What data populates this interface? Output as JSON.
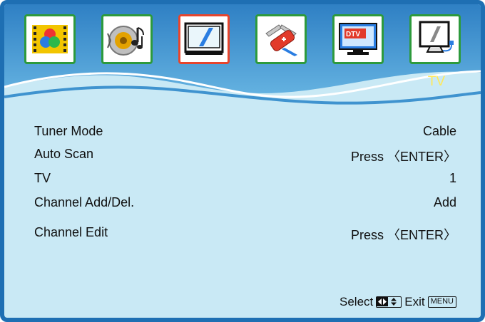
{
  "section_title": "TV",
  "tabs": [
    {
      "icon": "picture-icon",
      "active": false
    },
    {
      "icon": "sound-icon",
      "active": false
    },
    {
      "icon": "tv-icon",
      "active": true
    },
    {
      "icon": "settings-tools-icon",
      "active": false
    },
    {
      "icon": "dtv-icon",
      "active": false
    },
    {
      "icon": "pc-monitor-icon",
      "active": false
    }
  ],
  "menu": [
    {
      "label": "Tuner Mode",
      "value": "Cable"
    },
    {
      "label": "Auto Scan",
      "value": "Press 〈ENTER〉"
    },
    {
      "label": "TV",
      "value": "1"
    },
    {
      "label": "Channel Add/Del.",
      "value": "Add"
    },
    {
      "label": "Channel Edit",
      "value": "Press 〈ENTER〉"
    }
  ],
  "footer": {
    "select_label": "Select",
    "exit_label": "Exit",
    "menu_key": "MENU"
  },
  "colors": {
    "frame": "#1e6fb3",
    "background": "#c9e9f5",
    "active_tab": "#e8452c",
    "tab_border": "#2d9a3c",
    "title": "#ffe95a"
  }
}
